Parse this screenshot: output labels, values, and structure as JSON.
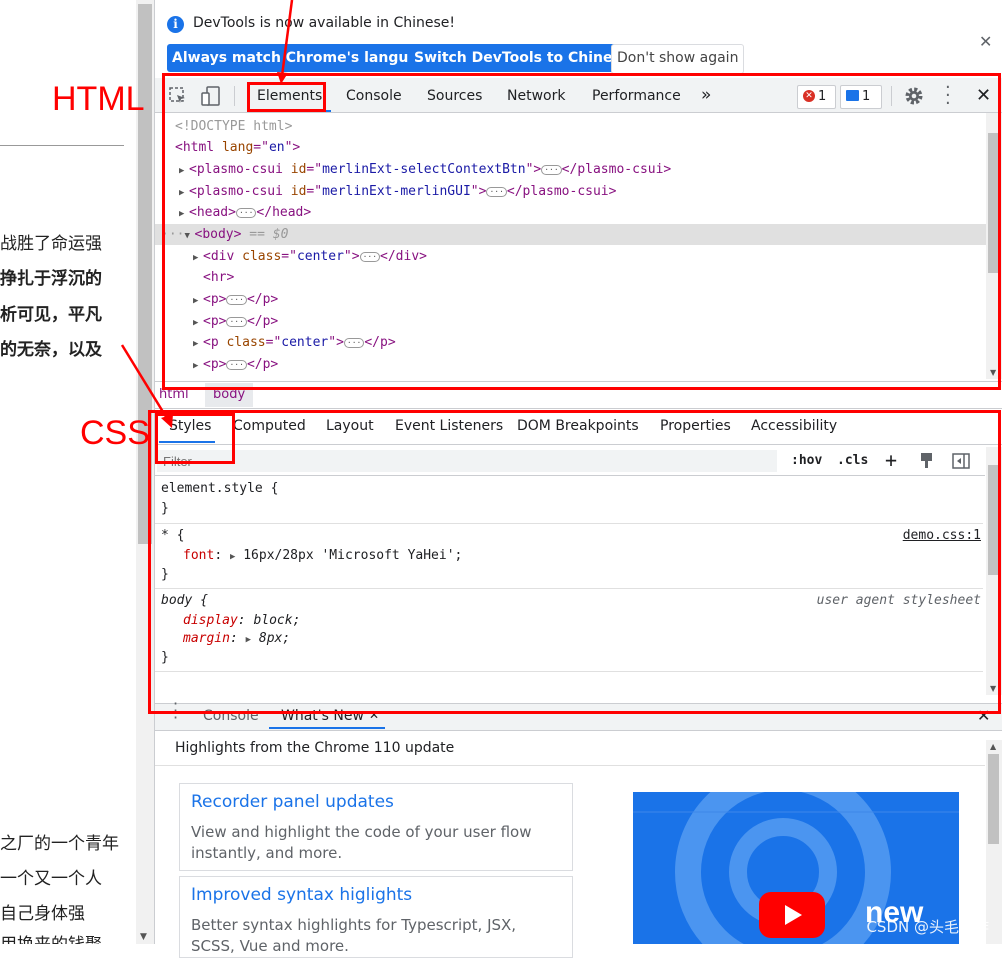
{
  "page": {
    "left_lines": [
      "战胜了命运强",
      "挣扎于浮沉的",
      "析可见，平凡",
      "的无奈，以及",
      "之厂的一个青年",
      "一个又一个人",
      "自己身体强",
      "用换来的钱聚"
    ]
  },
  "devtools": {
    "banner": {
      "text": "DevTools is now available in Chinese!",
      "buttons": [
        "Always match Chrome's language",
        "Switch DevTools to Chinese",
        "Don't show again"
      ]
    },
    "tabs": [
      "Elements",
      "Console",
      "Sources",
      "Network",
      "Performance",
      "»"
    ],
    "error_count": "1",
    "message_count": "1",
    "dom_lines": [
      {
        "doctype": "<!DOCTYPE html>"
      },
      {
        "tag": "html",
        "attr": "lang",
        "val": "en"
      },
      {
        "tag": "plasmo-csui",
        "attr": "id",
        "val": "merlinExt-selectContextBtn",
        "close": "</plasmo-csui>"
      },
      {
        "tag": "plasmo-csui",
        "attr": "id",
        "val": "merlinExt-merlinGUI",
        "close": "</plasmo-csui>"
      },
      {
        "tag": "head",
        "close": "</head>"
      },
      {
        "tag": "body",
        "note": "== $0"
      },
      {
        "tag": "div",
        "attr": "class",
        "val": "center",
        "close": "</div>"
      },
      {
        "tag": "hr"
      },
      {
        "tag": "p",
        "close": "</p>"
      },
      {
        "tag": "p",
        "close": "</p>"
      },
      {
        "tag": "p",
        "attr": "class",
        "val": "center",
        "close": "</p>"
      },
      {
        "tag": "p",
        "close": "</p>"
      }
    ],
    "breadcrumbs": [
      "html",
      "body"
    ],
    "styles_tabs": [
      "Styles",
      "Computed",
      "Layout",
      "Event Listeners",
      "DOM Breakpoints",
      "Properties",
      "Accessibility"
    ],
    "filter_placeholder": "Filter",
    "filter_tools": {
      "hov": ":hov",
      "cls": ".cls",
      "add": "+"
    },
    "rules": [
      {
        "selector": "element.style {",
        "close": "}"
      },
      {
        "selector": "* {",
        "source": "demo.css:1",
        "prop": "font",
        "value": "16px/28px 'Microsoft YaHei';",
        "close": "}"
      },
      {
        "selector": "body {",
        "source": "user agent stylesheet",
        "decls": [
          {
            "prop": "display",
            "value": "block;"
          },
          {
            "prop": "margin",
            "value": "8px;"
          }
        ],
        "close": "}"
      }
    ],
    "drawer_tabs": [
      "Console",
      "What's New"
    ],
    "whats_new": {
      "header": "Highlights from the Chrome 110 update",
      "cards": [
        {
          "title": "Recorder panel updates",
          "desc": "View and highlight the code of your user flow instantly, and more."
        },
        {
          "title": "Improved syntax higlights",
          "desc": "Better syntax highlights for Typescript, JSX, SCSS, Vue and more."
        }
      ],
      "promo_text": "new"
    }
  },
  "annotations": {
    "html_label": "HTML",
    "css_label": "CSS",
    "watermark": "CSDN @头毛很炸"
  },
  "colors": {
    "accent": "#1a73e8",
    "annotation_red": "#ff0000",
    "tag": "#881280",
    "attr_name": "#994500",
    "attr_value": "#1a1aa6"
  }
}
